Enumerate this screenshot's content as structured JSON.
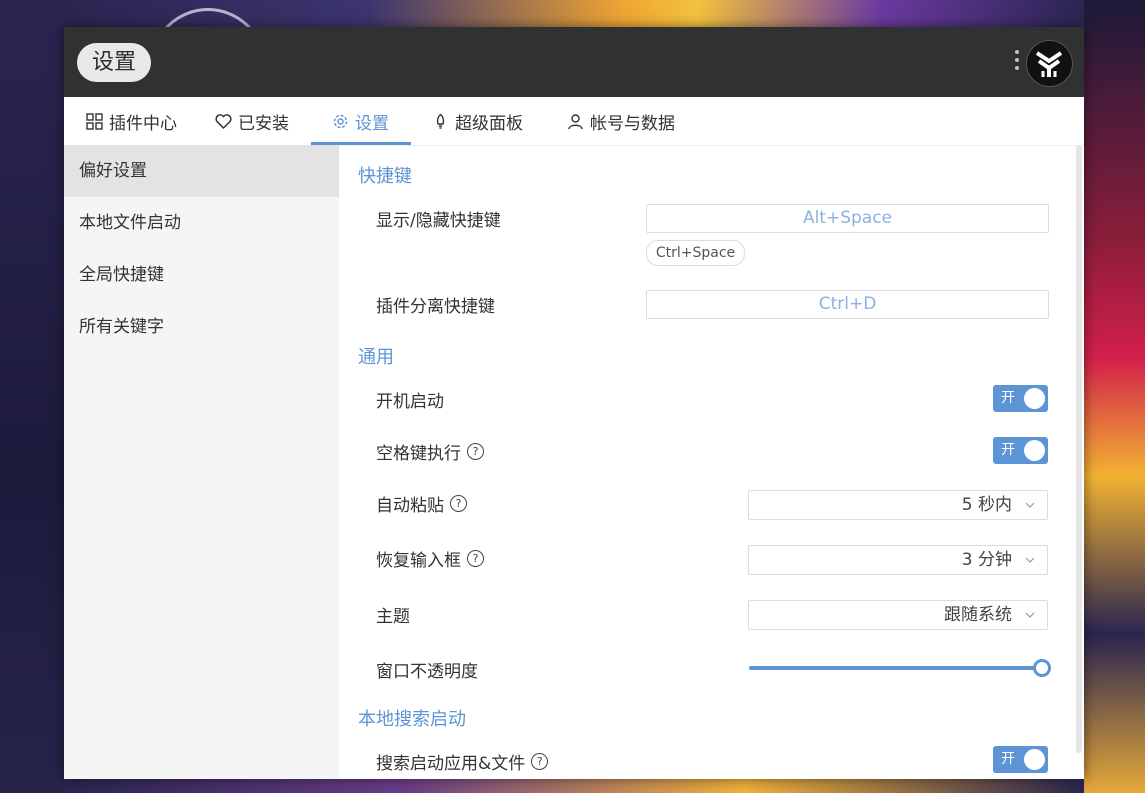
{
  "window": {
    "title": "设置"
  },
  "tabs": [
    {
      "label": "插件中心",
      "icon": "grid-icon"
    },
    {
      "label": "已安装",
      "icon": "heart-icon"
    },
    {
      "label": "设置",
      "icon": "gear-icon",
      "active": true
    },
    {
      "label": "超级面板",
      "icon": "bulb-icon"
    },
    {
      "label": "帐号与数据",
      "icon": "user-icon"
    }
  ],
  "sidebar": {
    "items": [
      {
        "label": "偏好设置",
        "active": true
      },
      {
        "label": "本地文件启动"
      },
      {
        "label": "全局快捷键"
      },
      {
        "label": "所有关键字"
      }
    ]
  },
  "settings": {
    "shortcuts": {
      "title": "快捷键",
      "show_hide_label": "显示/隐藏快捷键",
      "show_hide_value": "Alt+Space",
      "show_hide_alt": "Ctrl+Space",
      "detach_label": "插件分离快捷键",
      "detach_value": "Ctrl+D"
    },
    "general": {
      "title": "通用",
      "autostart_label": "开机启动",
      "autostart_state": "开",
      "space_exec_label": "空格键执行",
      "space_exec_state": "开",
      "autopaste_label": "自动粘贴",
      "autopaste_value": "5 秒内",
      "restore_input_label": "恢复输入框",
      "restore_input_value": "3 分钟",
      "theme_label": "主题",
      "theme_value": "跟随系统",
      "opacity_label": "窗口不透明度",
      "opacity_value": 1.0
    },
    "local_search": {
      "title": "本地搜索启动",
      "search_apps_label": "搜索启动应用&文件",
      "search_apps_state": "开"
    }
  },
  "colors": {
    "accent": "#5c94d6",
    "titlebar": "#2f3133"
  }
}
